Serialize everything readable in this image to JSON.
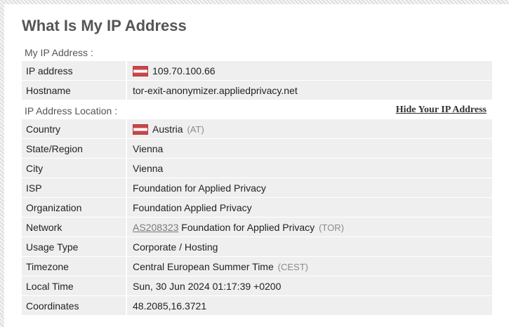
{
  "page": {
    "title": "What Is My IP Address"
  },
  "ip_section": {
    "label": "My IP Address :",
    "rows": [
      {
        "key": "IP address",
        "value": "109.70.100.66",
        "flag": "austria-flag-icon"
      },
      {
        "key": "Hostname",
        "value": "tor-exit-anonymizer.appliedprivacy.net"
      }
    ]
  },
  "location_section": {
    "label": "IP Address Location :",
    "hide_link": "Hide Your IP Address",
    "country": {
      "key": "Country",
      "value": "Austria",
      "code": "(AT)",
      "flag": "austria-flag-icon"
    },
    "state": {
      "key": "State/Region",
      "value": "Vienna"
    },
    "city": {
      "key": "City",
      "value": "Vienna"
    },
    "isp": {
      "key": "ISP",
      "value": "Foundation for Applied Privacy"
    },
    "organization": {
      "key": "Organization",
      "value": "Foundation Applied Privacy"
    },
    "network": {
      "key": "Network",
      "asn": "AS208323",
      "value": "Foundation for Applied Privacy",
      "tag": "(TOR)"
    },
    "usage_type": {
      "key": "Usage Type",
      "value": "Corporate / Hosting"
    },
    "timezone": {
      "key": "Timezone",
      "value": "Central European Summer Time",
      "abbr": "(CEST)"
    },
    "local_time": {
      "key": "Local Time",
      "value": "Sun, 30 Jun 2024 01:17:39 +0200"
    },
    "coordinates": {
      "key": "Coordinates",
      "value": "48.2085,16.3721"
    }
  },
  "colors": {
    "flag_red": "#c9464a",
    "row_bg": "#efefef",
    "title": "#555555"
  }
}
